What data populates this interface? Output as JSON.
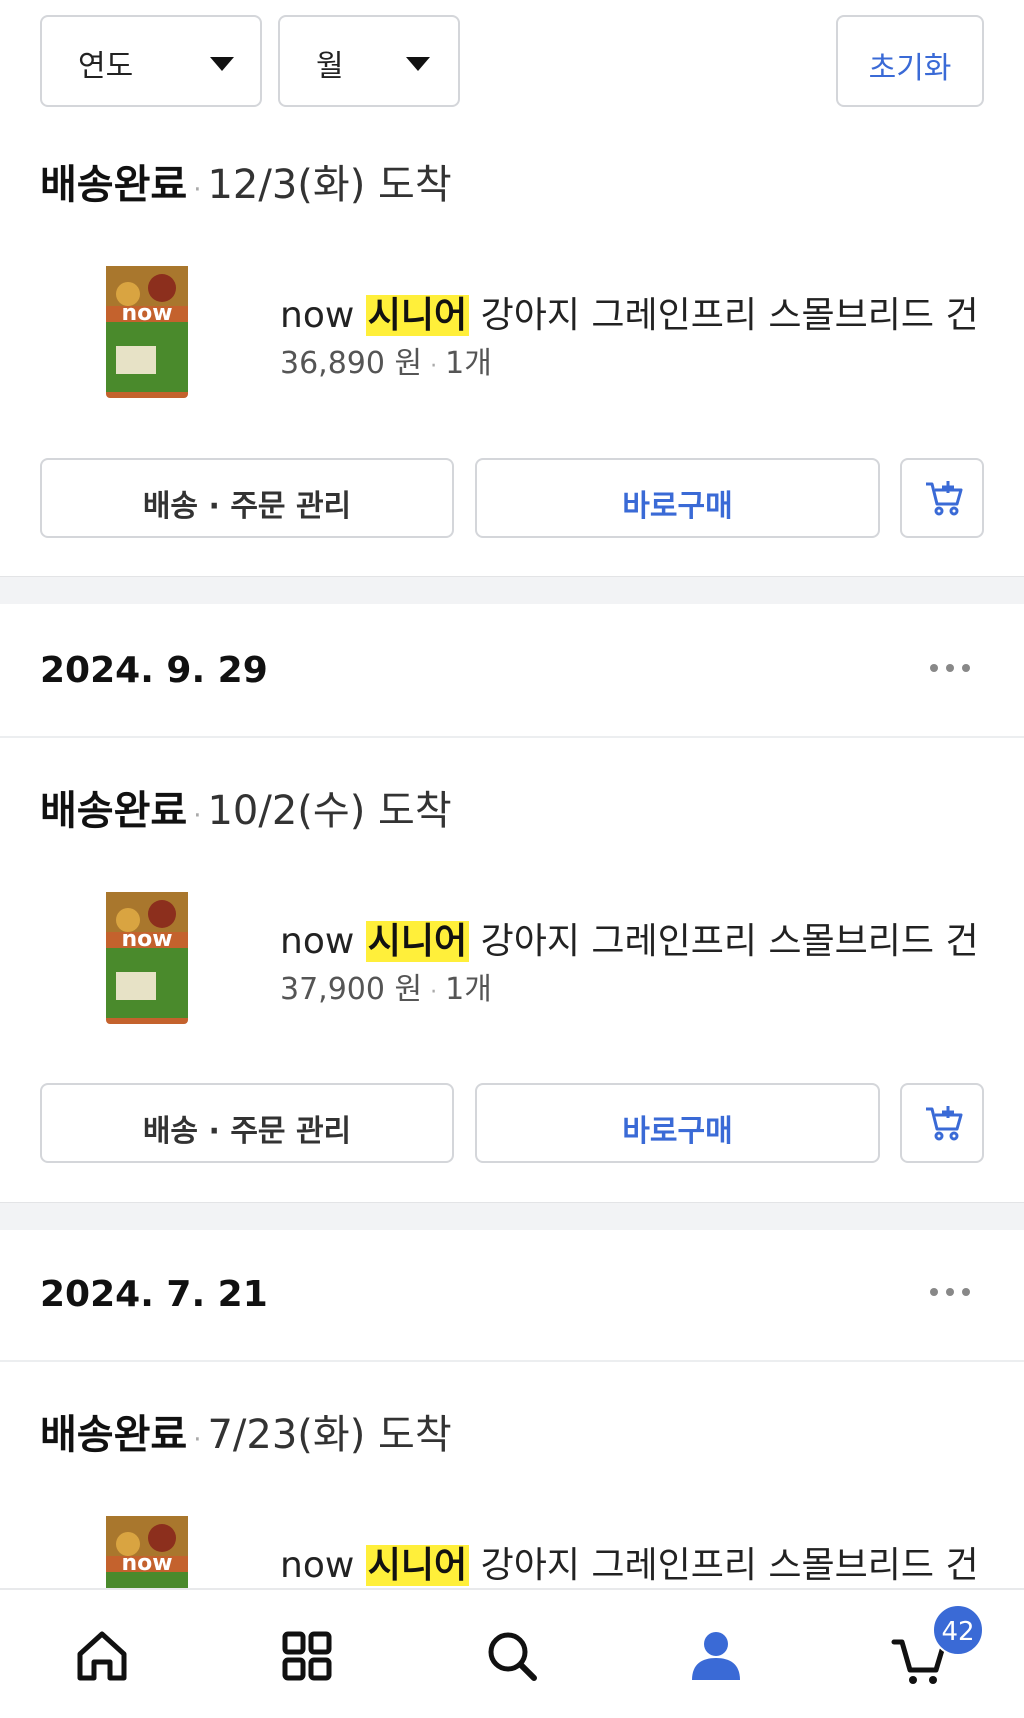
{
  "filters": {
    "year_label": "연도",
    "month_label": "월",
    "reset_label": "초기화"
  },
  "orders": [
    {
      "status": "배송완료",
      "arrival": "12/3(화) 도착",
      "product": {
        "brand": "now",
        "highlight": "시니어",
        "title_rest": "강아지 그레인프리 스몰브리드 건...",
        "price": "36,890 원",
        "quantity": "1개"
      },
      "manage_label": "배송 · 주문 관리",
      "buy_label": "바로구매"
    },
    {
      "order_date": "2024. 9. 29",
      "status": "배송완료",
      "arrival": "10/2(수) 도착",
      "product": {
        "brand": "now",
        "highlight": "시니어",
        "title_rest": "강아지 그레인프리 스몰브리드 건...",
        "price": "37,900 원",
        "quantity": "1개"
      },
      "manage_label": "배송 · 주문 관리",
      "buy_label": "바로구매"
    },
    {
      "order_date": "2024. 7. 21",
      "status": "배송완료",
      "arrival": "7/23(화) 도착",
      "product": {
        "brand": "now",
        "highlight": "시니어",
        "title_rest": "강아지 그레인프리 스몰브리드 건..."
      }
    }
  ],
  "bottom_nav": {
    "items": [
      "home-icon",
      "category-grid-icon",
      "search-icon",
      "user-icon",
      "cart-icon"
    ],
    "cart_badge": "42",
    "active_color": "#3a6ad6"
  },
  "colors": {
    "accent": "#3a6ad6",
    "highlight": "#ffef3a"
  }
}
